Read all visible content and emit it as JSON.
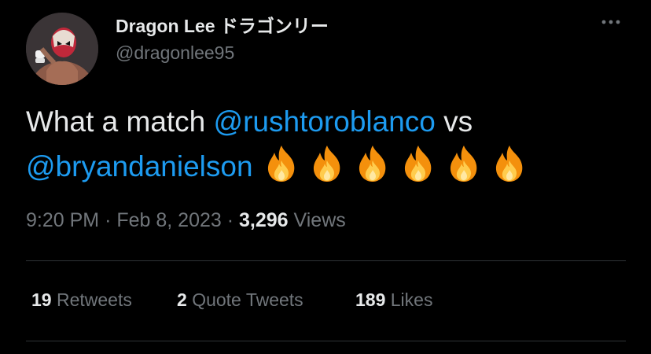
{
  "author": {
    "name": "Dragon Lee ドラゴンリー",
    "handle": "@dragonlee95"
  },
  "tweet": {
    "text_before": "What a match ",
    "mention1": "@rushtoroblanco",
    "text_middle": " vs",
    "mention2": "@bryandanielson",
    "emoji_icon": "fire-icon",
    "emoji_count": 6
  },
  "meta": {
    "time": "9:20 PM",
    "separator": "·",
    "date": "Feb 8, 2023",
    "views_count": "3,296",
    "views_label": "Views"
  },
  "stats": {
    "retweets_count": "19",
    "retweets_label": "Retweets",
    "quotes_count": "2",
    "quotes_label": "Quote Tweets",
    "likes_count": "189",
    "likes_label": "Likes"
  },
  "colors": {
    "background": "#000000",
    "text": "#e7e9ea",
    "secondary": "#71767b",
    "link": "#1d9bf0",
    "divider": "#2f3336"
  }
}
